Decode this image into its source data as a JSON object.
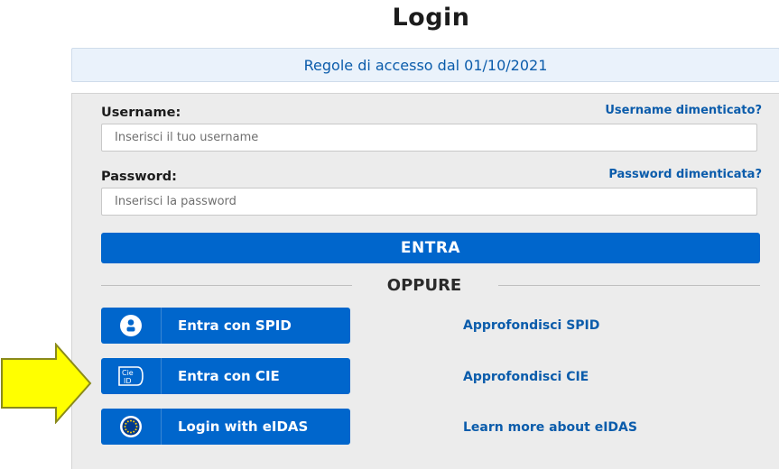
{
  "page": {
    "title": "Login"
  },
  "banner": {
    "text": "Regole di accesso dal 01/10/2021"
  },
  "form": {
    "username": {
      "label": "Username:",
      "forgot_link": "Username dimenticato?",
      "placeholder": "Inserisci il tuo username",
      "value": ""
    },
    "password": {
      "label": "Password:",
      "forgot_link": "Password dimenticata?",
      "placeholder": "Inserisci la password",
      "value": ""
    },
    "submit_label": "ENTRA"
  },
  "divider": {
    "text": "OPPURE"
  },
  "alt_logins": [
    {
      "icon": "spid-user-icon",
      "label": "Entra con SPID",
      "more_link": "Approfondisci SPID"
    },
    {
      "icon": "cie-id-card-icon",
      "label": "Entra con CIE",
      "more_link": "Approfondisci CIE"
    },
    {
      "icon": "eidas-eu-stars-icon",
      "label": "Login with eIDAS",
      "more_link": "Learn more about eIDAS"
    }
  ],
  "annotation": {
    "icon": "yellow-arrow-pointer",
    "color": "#ffff00"
  },
  "colors": {
    "primary": "#0066cc",
    "link": "#0b5cab",
    "banner_bg": "#eaf2fb",
    "panel_bg": "#ececec"
  }
}
